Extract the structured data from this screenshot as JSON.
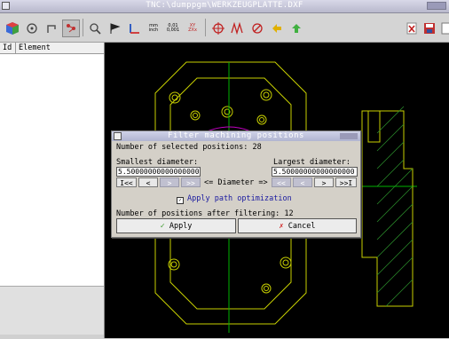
{
  "window": {
    "title": "TNC:\\dumppgm\\WERKZEUGPLATTE.DXF"
  },
  "left_panel": {
    "columns": [
      "Id",
      "Element"
    ]
  },
  "dialog": {
    "title": "Filter machining positions",
    "selected_label": "Number of selected positions: 28",
    "smallest_label": "Smallest diameter:",
    "largest_label": "Largest diameter:",
    "smallest_value": "5.50000000000000000",
    "largest_value": "5.50000000000000000",
    "left_buttons": [
      "I<<",
      "<",
      ">",
      ">>"
    ],
    "diameter_label": "<= Diameter =>",
    "right_buttons": [
      "<<",
      "<",
      ">",
      ">>I"
    ],
    "path_opt_label": "Apply path optimization",
    "path_opt_checked": true,
    "after_label": "Number of positions after filtering: 12",
    "apply_label": "Apply",
    "cancel_label": "Cancel"
  },
  "colors": {
    "canvas": "#000000",
    "geometry": "#c8d000",
    "circle": "#c000c0",
    "center": "#00b400",
    "hatch": "#2a8a2a",
    "dialog_text": "#1a1aa0"
  }
}
